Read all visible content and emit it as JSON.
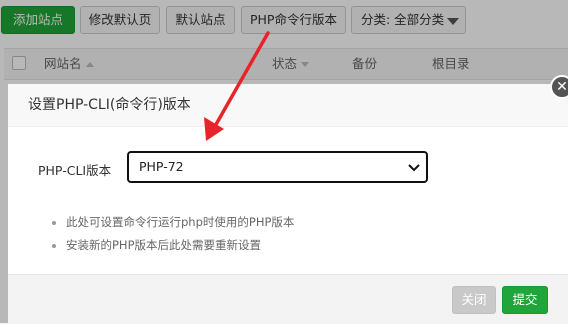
{
  "toolbar": {
    "add_site": "添加站点",
    "edit_default_page": "修改默认页",
    "default_site": "默认站点",
    "php_cli_version": "PHP命令行版本",
    "category_select": "分类: 全部分类"
  },
  "table": {
    "headers": [
      "网站名",
      "状态",
      "备份",
      "根目录"
    ]
  },
  "dialog": {
    "title": "设置PHP-CLI(命令行)版本",
    "field_label": "PHP-CLI版本",
    "selected_version": "PHP-72",
    "tips": [
      "此处可设置命令行运行php时使用的PHP版本",
      "安装新的PHP版本后此处需要重新设置"
    ],
    "close_label": "关闭",
    "submit_label": "提交",
    "close_glyph": "✕"
  },
  "colors": {
    "accent_green": "#20a53a",
    "annotation_red": "#e8242a"
  },
  "icons": [
    "close-icon",
    "chevron-down-icon",
    "sort-icon",
    "triangle-down-icon"
  ]
}
